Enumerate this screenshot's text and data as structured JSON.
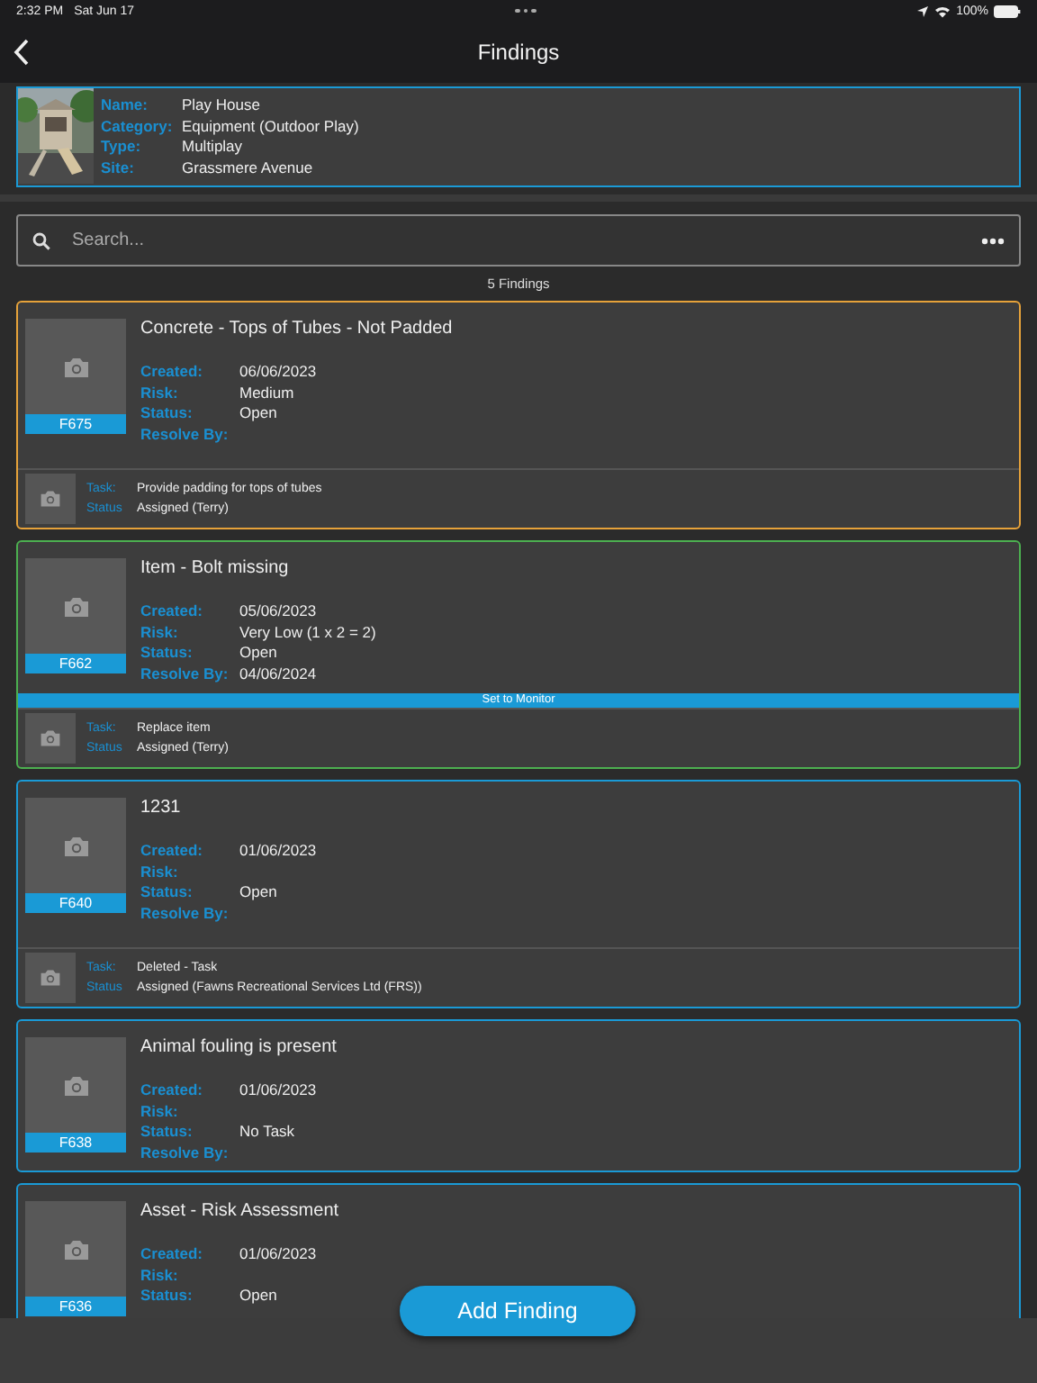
{
  "status_bar": {
    "time": "2:32 PM",
    "date": "Sat Jun 17",
    "battery": "100%"
  },
  "nav": {
    "title": "Findings"
  },
  "asset": {
    "fields": [
      {
        "label": "Name:",
        "value": "Play House"
      },
      {
        "label": "Category:",
        "value": "Equipment (Outdoor Play)"
      },
      {
        "label": "Type:",
        "value": "Multiplay"
      },
      {
        "label": "Site:",
        "value": "Grassmere Avenue"
      }
    ]
  },
  "search": {
    "placeholder": "Search..."
  },
  "count": "5 Findings",
  "findings": [
    {
      "code": "F675",
      "title": "Concrete - Tops of Tubes - Not Padded",
      "color": "#e6a23a",
      "fields": [
        {
          "label": "Created:",
          "value": "06/06/2023"
        },
        {
          "label": "Risk:",
          "value": "Medium"
        },
        {
          "label": "Status:",
          "value": "Open"
        },
        {
          "label": "Resolve By:"
        }
      ],
      "task": [
        {
          "label": "Task:",
          "value": "Provide padding for tops of tubes"
        },
        {
          "label": "Status",
          "value": "Assigned (Terry)"
        }
      ]
    },
    {
      "code": "F662",
      "title": "Item - Bolt missing",
      "color": "#4caf50",
      "fields": [
        {
          "label": "Created:",
          "value": "05/06/2023"
        },
        {
          "label": "Risk:",
          "value": "Very Low (1 x 2 = 2)"
        },
        {
          "label": "Status:",
          "value": "Open"
        },
        {
          "label": "Resolve By:",
          "value": "04/06/2024"
        }
      ],
      "banner": "Set to Monitor",
      "task": [
        {
          "label": "Task:",
          "value": "Replace item"
        },
        {
          "label": "Status",
          "value": "Assigned (Terry)"
        }
      ]
    },
    {
      "code": "F640",
      "title": "1231",
      "color": "#1a9ad6",
      "fields": [
        {
          "label": "Created:",
          "value": "01/06/2023"
        },
        {
          "label": "Risk:"
        },
        {
          "label": "Status:",
          "value": "Open"
        },
        {
          "label": "Resolve By:"
        }
      ],
      "task": [
        {
          "label": "Task:",
          "value": "Deleted - Task"
        },
        {
          "label": "Status",
          "value": "Assigned (Fawns Recreational Services Ltd (FRS))"
        }
      ]
    },
    {
      "code": "F638",
      "title": "Animal fouling is present",
      "color": "#1a9ad6",
      "fields": [
        {
          "label": "Created:",
          "value": "01/06/2023"
        },
        {
          "label": "Risk:"
        },
        {
          "label": "Status:",
          "value": "No Task"
        },
        {
          "label": "Resolve By:"
        }
      ]
    },
    {
      "code": "F636",
      "title": "Asset - Risk Assessment",
      "color": "#1a9ad6",
      "fields": [
        {
          "label": "Created:",
          "value": "01/06/2023"
        },
        {
          "label": "Risk:"
        },
        {
          "label": "Status:",
          "value": "Open"
        }
      ]
    }
  ],
  "add_button": "Add Finding"
}
